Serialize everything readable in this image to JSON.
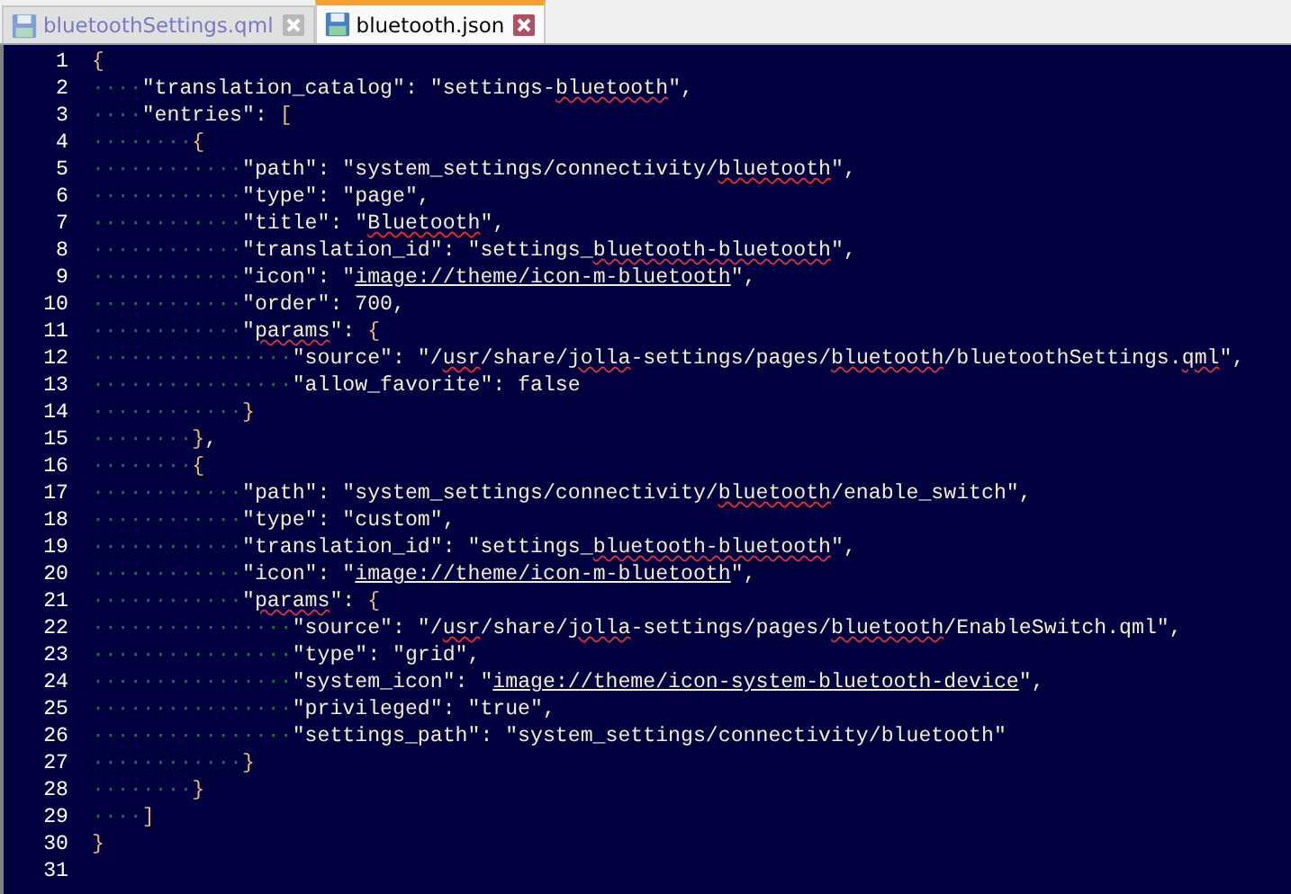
{
  "tabs": [
    {
      "label": "bluetoothSettings.qml",
      "selected": false
    },
    {
      "label": "bluetooth.json",
      "selected": true
    }
  ],
  "editor": {
    "lines": [
      {
        "number": "1",
        "tokens": [
          {
            "text": "{",
            "kind": "brace"
          }
        ]
      },
      {
        "number": "2",
        "indent": "····",
        "tokens": [
          {
            "text": "\"translation_catalog\": \"settings-",
            "kind": "text"
          },
          {
            "text": "bluetooth",
            "kind": "misspelled"
          },
          {
            "text": "\",",
            "kind": "text"
          }
        ]
      },
      {
        "number": "3",
        "indent": "····",
        "tokens": [
          {
            "text": "\"entries\": ",
            "kind": "text"
          },
          {
            "text": "[",
            "kind": "brace"
          }
        ]
      },
      {
        "number": "4",
        "indent": "········",
        "tokens": [
          {
            "text": "{",
            "kind": "brace"
          }
        ]
      },
      {
        "number": "5",
        "indent": "············",
        "tokens": [
          {
            "text": "\"path\": \"system_settings/connectivity/",
            "kind": "text"
          },
          {
            "text": "bluetooth",
            "kind": "misspelled"
          },
          {
            "text": "\",",
            "kind": "text"
          }
        ]
      },
      {
        "number": "6",
        "indent": "············",
        "tokens": [
          {
            "text": "\"type\": \"page\",",
            "kind": "text"
          }
        ]
      },
      {
        "number": "7",
        "indent": "············",
        "tokens": [
          {
            "text": "\"title\": \"",
            "kind": "text"
          },
          {
            "text": "Bluetooth",
            "kind": "misspelled"
          },
          {
            "text": "\",",
            "kind": "text"
          }
        ]
      },
      {
        "number": "8",
        "indent": "············",
        "tokens": [
          {
            "text": "\"translation_id\": \"settings_",
            "kind": "text"
          },
          {
            "text": "bluetooth-bluetooth",
            "kind": "misspelled"
          },
          {
            "text": "\",",
            "kind": "text"
          }
        ]
      },
      {
        "number": "9",
        "indent": "············",
        "tokens": [
          {
            "text": "\"icon\": \"",
            "kind": "text"
          },
          {
            "text": "image://theme/icon-m-bluetooth",
            "kind": "link"
          },
          {
            "text": "\",",
            "kind": "text"
          }
        ]
      },
      {
        "number": "10",
        "indent": "············",
        "tokens": [
          {
            "text": "\"order\": 700,",
            "kind": "text"
          }
        ]
      },
      {
        "number": "11",
        "indent": "············",
        "tokens": [
          {
            "text": "\"",
            "kind": "text"
          },
          {
            "text": "params",
            "kind": "misspelled"
          },
          {
            "text": "\": ",
            "kind": "text"
          },
          {
            "text": "{",
            "kind": "brace"
          }
        ]
      },
      {
        "number": "12",
        "indent": "················",
        "tokens": [
          {
            "text": "\"source\": \"/",
            "kind": "text"
          },
          {
            "text": "usr",
            "kind": "misspelled"
          },
          {
            "text": "/share/",
            "kind": "text"
          },
          {
            "text": "jolla",
            "kind": "misspelled"
          },
          {
            "text": "-settings/pages/",
            "kind": "text"
          },
          {
            "text": "bluetooth",
            "kind": "misspelled"
          },
          {
            "text": "/bluetoothSettings.",
            "kind": "text"
          },
          {
            "text": "qml",
            "kind": "misspelled"
          },
          {
            "text": "\",",
            "kind": "text"
          }
        ]
      },
      {
        "number": "13",
        "indent": "················",
        "tokens": [
          {
            "text": "\"allow_favorite\": false",
            "kind": "text"
          }
        ]
      },
      {
        "number": "14",
        "indent": "············",
        "tokens": [
          {
            "text": "}",
            "kind": "brace"
          }
        ]
      },
      {
        "number": "15",
        "indent": "········",
        "tokens": [
          {
            "text": "}",
            "kind": "brace"
          },
          {
            "text": ",",
            "kind": "text"
          }
        ]
      },
      {
        "number": "16",
        "indent": "········",
        "tokens": [
          {
            "text": "{",
            "kind": "brace"
          }
        ]
      },
      {
        "number": "17",
        "indent": "············",
        "tokens": [
          {
            "text": "\"path\": \"system_settings/connectivity/",
            "kind": "text"
          },
          {
            "text": "bluetooth",
            "kind": "misspelled"
          },
          {
            "text": "/enable_switch\",",
            "kind": "text"
          }
        ]
      },
      {
        "number": "18",
        "indent": "············",
        "tokens": [
          {
            "text": "\"type\": \"custom\",",
            "kind": "text"
          }
        ]
      },
      {
        "number": "19",
        "indent": "············",
        "tokens": [
          {
            "text": "\"translation_id\": \"settings_",
            "kind": "text"
          },
          {
            "text": "bluetooth-bluetooth",
            "kind": "misspelled"
          },
          {
            "text": "\",",
            "kind": "text"
          }
        ]
      },
      {
        "number": "20",
        "indent": "············",
        "tokens": [
          {
            "text": "\"icon\": \"",
            "kind": "text"
          },
          {
            "text": "image://theme/icon-m-bluetooth",
            "kind": "link"
          },
          {
            "text": "\",",
            "kind": "text"
          }
        ]
      },
      {
        "number": "21",
        "indent": "············",
        "tokens": [
          {
            "text": "\"",
            "kind": "text"
          },
          {
            "text": "params",
            "kind": "misspelled"
          },
          {
            "text": "\": ",
            "kind": "text"
          },
          {
            "text": "{",
            "kind": "brace"
          }
        ]
      },
      {
        "number": "22",
        "indent": "················",
        "tokens": [
          {
            "text": "\"source\": \"/",
            "kind": "text"
          },
          {
            "text": "usr",
            "kind": "misspelled"
          },
          {
            "text": "/share/",
            "kind": "text"
          },
          {
            "text": "jolla",
            "kind": "misspelled"
          },
          {
            "text": "-settings/pages/",
            "kind": "text"
          },
          {
            "text": "bluetooth",
            "kind": "misspelled"
          },
          {
            "text": "/EnableSwitch.qml\",",
            "kind": "text"
          }
        ]
      },
      {
        "number": "23",
        "indent": "················",
        "tokens": [
          {
            "text": "\"type\": \"grid\",",
            "kind": "text"
          }
        ]
      },
      {
        "number": "24",
        "indent": "················",
        "tokens": [
          {
            "text": "\"system_icon\": \"",
            "kind": "text"
          },
          {
            "text": "image://theme/icon-system-bluetooth-device",
            "kind": "link"
          },
          {
            "text": "\",",
            "kind": "text"
          }
        ]
      },
      {
        "number": "25",
        "indent": "················",
        "tokens": [
          {
            "text": "\"privileged\": \"true\",",
            "kind": "text"
          }
        ]
      },
      {
        "number": "26",
        "indent": "················",
        "tokens": [
          {
            "text": "\"settings_path\": \"system_settings/connectivity/bluetooth\"",
            "kind": "text"
          }
        ]
      },
      {
        "number": "27",
        "indent": "············",
        "tokens": [
          {
            "text": "}",
            "kind": "brace"
          }
        ]
      },
      {
        "number": "28",
        "indent": "········",
        "tokens": [
          {
            "text": "}",
            "kind": "brace"
          }
        ]
      },
      {
        "number": "29",
        "indent": "····",
        "tokens": [
          {
            "text": "]",
            "kind": "brace"
          }
        ]
      },
      {
        "number": "30",
        "tokens": [
          {
            "text": "}",
            "kind": "brace"
          }
        ]
      },
      {
        "number": "31"
      }
    ]
  }
}
